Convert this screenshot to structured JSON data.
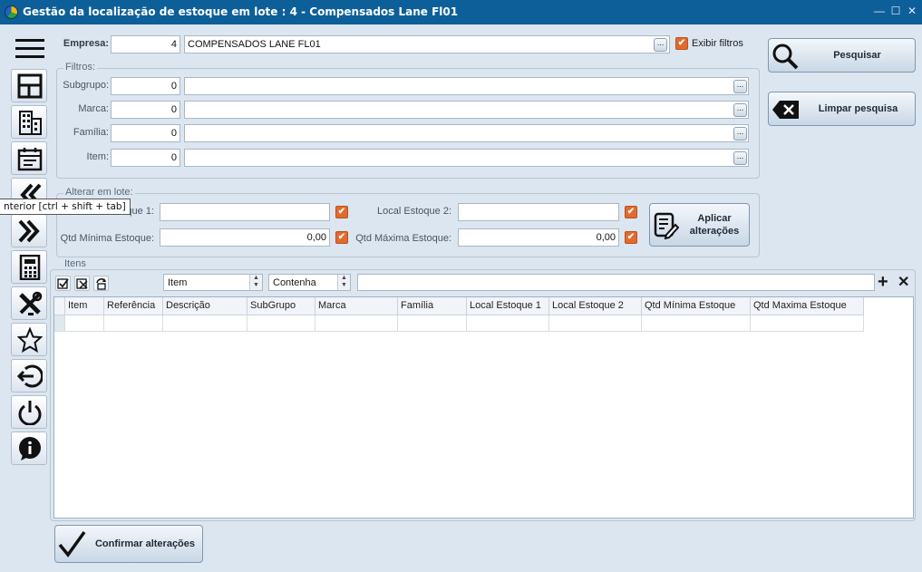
{
  "window": {
    "title": "Gestão da localização de estoque em lote : 4 - Compensados Lane Fl01",
    "controls": {
      "minimize": "—",
      "maximize": "☐",
      "close": "✕"
    }
  },
  "sidebar": {
    "items": [
      {
        "icon": "menu-icon"
      },
      {
        "icon": "layout-icon"
      },
      {
        "icon": "building-icon"
      },
      {
        "icon": "calendar-icon"
      },
      {
        "icon": "previous-icon"
      },
      {
        "icon": "next-icon"
      },
      {
        "icon": "calculator-icon"
      },
      {
        "icon": "tools-icon"
      },
      {
        "icon": "star-icon"
      },
      {
        "icon": "logout-icon"
      },
      {
        "icon": "power-icon"
      },
      {
        "icon": "info-icon"
      }
    ],
    "tooltip": "nterior [ctrl + shift + tab]"
  },
  "empresa": {
    "label": "Empresa:",
    "code": "4",
    "name": "COMPENSADOS LANE FL01",
    "lookup": "...",
    "show_filters_label": "Exibir filtros",
    "show_filters_checked": true
  },
  "filtros": {
    "title": "Filtros:",
    "rows": [
      {
        "label": "Subgrupo:",
        "code": "0",
        "desc": "",
        "lookup": "..."
      },
      {
        "label": "Marca:",
        "code": "0",
        "desc": "",
        "lookup": "..."
      },
      {
        "label": "Família:",
        "code": "0",
        "desc": "",
        "lookup": "..."
      },
      {
        "label": "Item:",
        "code": "0",
        "desc": "",
        "lookup": "..."
      }
    ]
  },
  "alterar": {
    "title": "Alterar em lote:",
    "local1_label": "toque 1:",
    "local1_value": "",
    "local2_label": "Local Estoque 2:",
    "local2_value": "",
    "qtd_min_label": "Qtd Mínima Estoque:",
    "qtd_min_value": "0,00",
    "qtd_max_label": "Qtd Máxima Estoque:",
    "qtd_max_value": "0,00",
    "apply_label_1": "Aplicar",
    "apply_label_2": "alterações",
    "checks": [
      true,
      true,
      true,
      true
    ]
  },
  "actions": {
    "search_label": "Pesquisar",
    "clear_label": "Limpar pesquisa",
    "confirm_label": "Confirmar alterações"
  },
  "itens": {
    "title": "Itens",
    "field_select": "Item",
    "operator_select": "Contenha",
    "search_value": "",
    "add": "+",
    "remove": "✕",
    "columns": [
      "Item",
      "Referência",
      "Descrição",
      "SubGrupo",
      "Marca",
      "Família",
      "Local Estoque 1",
      "Local Estoque 2",
      "Qtd Mínima Estoque",
      "Qtd Maxima Estoque"
    ],
    "rows": []
  },
  "colors": {
    "titlebar": "#0d5f9a",
    "background": "#dbe6f0",
    "checkbox": "#e26a2c"
  }
}
